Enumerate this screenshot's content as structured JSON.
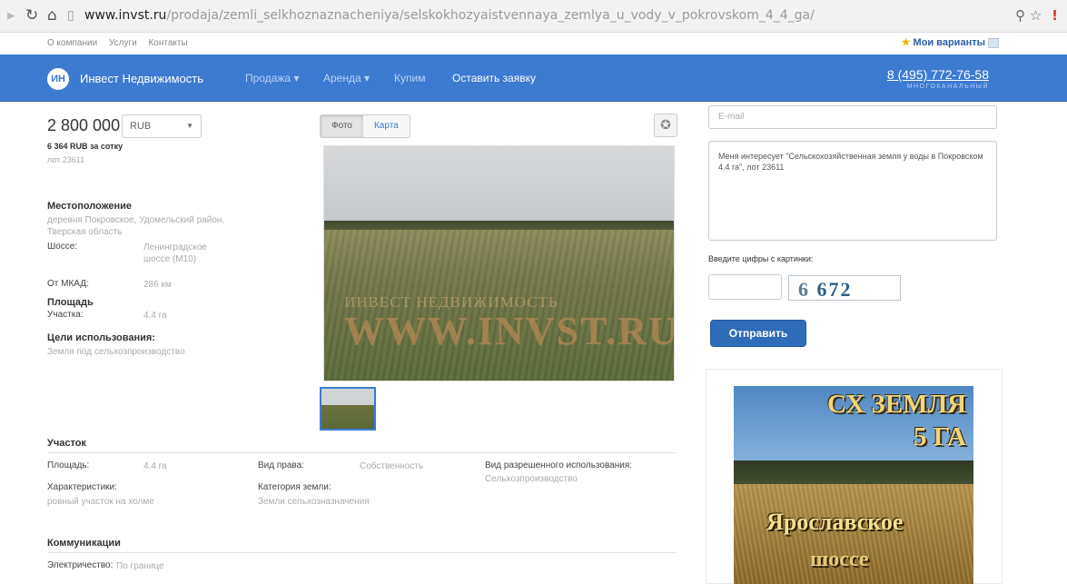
{
  "browser": {
    "url_domain": "www.invst.ru",
    "url_path": "/prodaja/zemli_selkhoznaznacheniya/selskokhozyaistvennaya_zemlya_u_vody_v_pokrovskom_4_4_ga/"
  },
  "util": {
    "links": [
      "О компании",
      "Услуги",
      "Контакты"
    ],
    "favorites": "Мои варианты"
  },
  "navbar": {
    "logo": "ИН",
    "brand": "Инвест Недвижимость",
    "items": [
      "Продажа",
      "Аренда",
      "Купим"
    ],
    "cta": "Оставить заявку",
    "phone": "8 (495) 772-76-58",
    "phone_sub": "МНОГОКАНАЛЬНЫЙ"
  },
  "listing": {
    "price": "2 800 000",
    "currency": "RUB",
    "per_hundred": "6 364 RUB за сотку",
    "lot": "лот 23611",
    "location_title": "Местоположение",
    "location_lines": [
      "деревня Покровское, Удомельский район,",
      "Тверская область"
    ],
    "highway_key": "Шоссе:",
    "highway_lines": [
      "Ленинградское",
      "шоссе (М10)"
    ],
    "mkad_key": "От МКАД:",
    "mkad_val": "286 км",
    "area_title": "Площадь",
    "plot_key": "Участка:",
    "plot_val": "4.4 га",
    "purpose_title": "Цели использования:",
    "purpose_val": "Земля под сельхозпроизводство"
  },
  "photo": {
    "tabs": [
      "Фото",
      "Карта"
    ],
    "watermark_small": "ИНВЕСТ НЕДВИЖИМОСТЬ",
    "watermark_big": "WWW.INVST.RU"
  },
  "form": {
    "email_placeholder": "E-mail",
    "message": "Меня интересует \"Сельскохозяйственная земля у воды в Покровском 4.4 га\", лот 23611",
    "captcha_label": "Введите цифры с картинки:",
    "captcha_digits": "6",
    "captcha_digits2": "672",
    "submit": "Отправить"
  },
  "ad": {
    "line1": "СХ ЗЕМЛЯ",
    "line2": "5 ГА",
    "line3": "Ярославское",
    "line4": "шоссе"
  },
  "plot_section": {
    "title": "Участок",
    "area_key": "Площадь:",
    "area_val": "4.4 га",
    "right_key": "Вид права:",
    "right_val": "Собственность",
    "use_key": "Вид разрешенного использования:",
    "use_val": "Сельхозпроизводство",
    "char_key": "Характеристики:",
    "char_val": "ровный участок на холме",
    "cat_key": "Категория земли:",
    "cat_val": "Земли сельхозназначения"
  },
  "comm_section": {
    "title": "Коммуникации",
    "elec_key": "Электричество:",
    "elec_val": "По границе"
  }
}
